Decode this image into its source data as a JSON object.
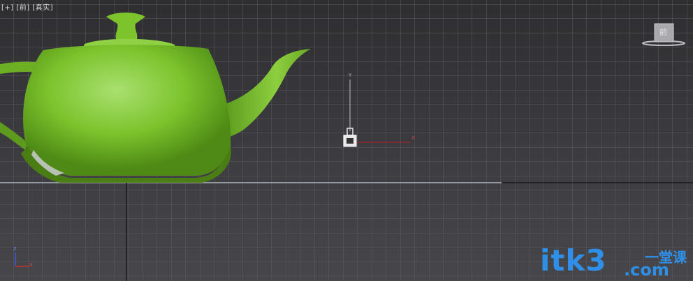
{
  "viewport": {
    "label_plus": "[+]",
    "label_view": "[前]",
    "label_shading": "[真实]",
    "viewcube_face": "前",
    "object_color": "#7cc32c",
    "grid_color": "#55555a"
  },
  "gizmo": {
    "axis_y": "Y",
    "axis_x": "X"
  },
  "corner_axes": {
    "z": "Z",
    "x": "X"
  },
  "watermark": {
    "brand": "itk3",
    "cn": "一堂课",
    "domain": ".com"
  }
}
